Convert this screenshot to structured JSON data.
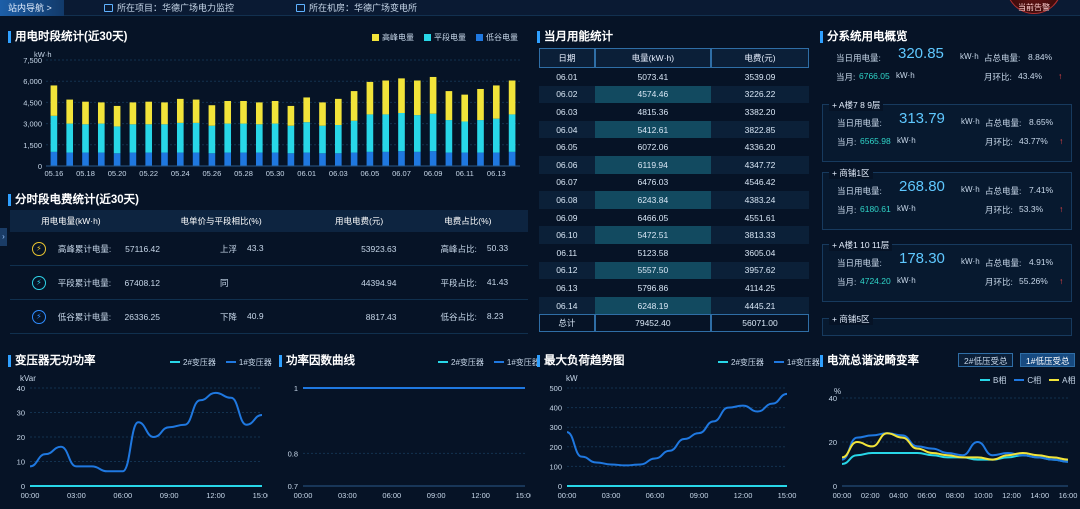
{
  "topbar": {
    "nav_label": "站内导航 >",
    "project_label": "所在项目：华德广场电力监控",
    "room_label": "所在机房：华德广场变电所",
    "alarm_label": "当前告警"
  },
  "usage30": {
    "title": "用电时段统计(近30天)",
    "unit": "kW·h",
    "legend": [
      "高峰电量",
      "平段电量",
      "低谷电量"
    ],
    "colors": {
      "peak": "#f2e43a",
      "flat": "#28d7e8",
      "valley": "#1f78e0"
    }
  },
  "cost30": {
    "title": "分时段电费统计(近30天)",
    "headers": [
      "用电电量(kW·h)",
      "电单价与平段相比(%)",
      "用电电费(元)",
      "电费占比(%)"
    ],
    "rows": [
      {
        "icon": "peak-bolt-icon",
        "label": "高峰累计电量:",
        "value": "57116.42",
        "dir": "上浮",
        "pct": "43.3",
        "money": "53923.63",
        "ratio_label": "高峰占比:",
        "ratio": "50.33"
      },
      {
        "icon": "flat-bolt-icon",
        "label": "平段累计电量:",
        "value": "67408.12",
        "dir": "同",
        "pct": "",
        "money": "44394.94",
        "ratio_label": "平段占比:",
        "ratio": "41.43"
      },
      {
        "icon": "valley-bolt-icon",
        "label": "低谷累计电量:",
        "value": "26336.25",
        "dir": "下降",
        "pct": "40.9",
        "money": "8817.43",
        "ratio_label": "低谷占比:",
        "ratio": "8.23"
      }
    ]
  },
  "monthly": {
    "title": "当月用能统计",
    "headers": [
      "日期",
      "电量(kW·h)",
      "电费(元)"
    ],
    "rows": [
      [
        "06.01",
        "5073.41",
        "3539.09"
      ],
      [
        "06.02",
        "4574.46",
        "3226.22"
      ],
      [
        "06.03",
        "4815.36",
        "3382.20"
      ],
      [
        "06.04",
        "5412.61",
        "3822.85"
      ],
      [
        "06.05",
        "6072.06",
        "4336.20"
      ],
      [
        "06.06",
        "6119.94",
        "4347.72"
      ],
      [
        "06.07",
        "6476.03",
        "4546.42"
      ],
      [
        "06.08",
        "6243.84",
        "4383.24"
      ],
      [
        "06.09",
        "6466.05",
        "4551.61"
      ],
      [
        "06.10",
        "5472.51",
        "3813.33"
      ],
      [
        "06.11",
        "5123.58",
        "3605.04"
      ],
      [
        "06.12",
        "5557.50",
        "3957.62"
      ],
      [
        "06.13",
        "5796.86",
        "4114.25"
      ],
      [
        "06.14",
        "6248.19",
        "4445.21"
      ]
    ],
    "total": [
      "总计",
      "79452.40",
      "56071.00"
    ]
  },
  "subsystems": {
    "title": "分系统用电概览",
    "today_label": "当日用电量:",
    "month_label": "当月:",
    "share_label": "占总电量:",
    "mom_label": "月环比:",
    "unit": "kW·h",
    "cards": [
      {
        "name": "",
        "today": "320.85",
        "share": "8.84%",
        "month": "6766.05",
        "mom": "43.4%"
      },
      {
        "name": "A楼7 8 9层",
        "today": "313.79",
        "share": "8.65%",
        "month": "6565.98",
        "mom": "43.77%"
      },
      {
        "name": "商铺1区",
        "today": "268.80",
        "share": "7.41%",
        "month": "6180.61",
        "mom": "53.3%"
      },
      {
        "name": "A楼1 10 11层",
        "today": "178.30",
        "share": "4.91%",
        "month": "4724.20",
        "mom": "55.26%"
      },
      {
        "name": "商铺5区",
        "today": "",
        "share": "",
        "month": "",
        "mom": ""
      }
    ]
  },
  "reactive": {
    "title": "变压器无功功率",
    "unit": "kVar",
    "legend": [
      "2#变压器",
      "1#变压器"
    ]
  },
  "pf": {
    "title": "功率因数曲线",
    "legend": [
      "2#变压器",
      "1#变压器"
    ]
  },
  "maxload": {
    "title": "最大负荷趋势图",
    "unit": "kW",
    "legend": [
      "2#变压器",
      "1#变压器"
    ]
  },
  "thd": {
    "title": "电流总谐波畸变率",
    "unit": "%",
    "tabs": [
      "2#低压受总",
      "1#低压受总"
    ],
    "legend": [
      "B相",
      "C相",
      "A相"
    ]
  },
  "chart_data": [
    {
      "type": "bar",
      "title": "用电时段统计(近30天)",
      "ylabel": "kW·h",
      "ylim": [
        0,
        7500
      ],
      "yticks": [
        0,
        1500,
        3000,
        4500,
        6000,
        7500
      ],
      "categories": [
        "05.16",
        "05.17",
        "05.18",
        "05.19",
        "05.20",
        "05.21",
        "05.22",
        "05.23",
        "05.24",
        "05.25",
        "05.26",
        "05.27",
        "05.28",
        "05.29",
        "05.30",
        "05.31",
        "06.01",
        "06.02",
        "06.03",
        "06.04",
        "06.05",
        "06.06",
        "06.07",
        "06.08",
        "06.09",
        "06.10",
        "06.11",
        "06.12",
        "06.13",
        "06.14"
      ],
      "xtick_labels": [
        "05.16",
        "05.18",
        "05.20",
        "05.22",
        "05.24",
        "05.26",
        "05.28",
        "05.30",
        "06.01",
        "06.03",
        "06.05",
        "06.07",
        "06.09",
        "06.11",
        "06.13"
      ],
      "stacked": true,
      "series": [
        {
          "name": "低谷电量",
          "values": [
            1000,
            950,
            950,
            950,
            900,
            950,
            950,
            950,
            950,
            950,
            900,
            950,
            950,
            950,
            950,
            900,
            950,
            900,
            900,
            950,
            1000,
            1000,
            1050,
            1000,
            1050,
            950,
            950,
            950,
            950,
            1000
          ]
        },
        {
          "name": "平段电量",
          "values": [
            2550,
            2050,
            2000,
            2050,
            1900,
            2000,
            2000,
            2000,
            2100,
            2100,
            1950,
            2050,
            2050,
            2000,
            2050,
            1950,
            2150,
            1950,
            2000,
            2250,
            2650,
            2650,
            2700,
            2600,
            2650,
            2300,
            2200,
            2300,
            2400,
            2650
          ]
        },
        {
          "name": "高峰电量",
          "values": [
            2150,
            1700,
            1600,
            1500,
            1450,
            1550,
            1600,
            1550,
            1700,
            1650,
            1450,
            1600,
            1600,
            1550,
            1600,
            1400,
            1750,
            1650,
            1850,
            2100,
            2300,
            2400,
            2450,
            2450,
            2600,
            2050,
            1900,
            2200,
            2350,
            2400
          ]
        }
      ]
    },
    {
      "type": "line",
      "title": "变压器无功功率",
      "ylabel": "kVar",
      "ylim": [
        0,
        40
      ],
      "yticks": [
        0,
        10,
        20,
        30,
        40
      ],
      "xtick_labels": [
        "00:00",
        "03:00",
        "06:00",
        "09:00",
        "12:00",
        "15:00"
      ],
      "x": [
        0,
        1,
        2,
        3,
        4,
        5,
        6,
        7,
        8,
        9,
        10,
        11,
        12,
        13,
        14,
        15
      ],
      "series": [
        {
          "name": "2#变压器",
          "values": [
            0,
            0,
            0,
            0,
            0,
            0,
            0,
            0,
            0,
            0,
            0,
            0,
            0,
            0,
            0,
            0
          ]
        },
        {
          "name": "1#变压器",
          "values": [
            8,
            13,
            16,
            8,
            8,
            6,
            6,
            26,
            20,
            24,
            25,
            35,
            38,
            36,
            25,
            29
          ]
        }
      ]
    },
    {
      "type": "line",
      "title": "功率因数曲线",
      "ylim": [
        0.7,
        1
      ],
      "yticks": [
        0.7,
        0.8,
        1
      ],
      "xtick_labels": [
        "00:00",
        "03:00",
        "06:00",
        "09:00",
        "12:00",
        "15:00"
      ],
      "x": [
        0,
        15
      ],
      "series": [
        {
          "name": "2#变压器",
          "values": [
            1,
            1
          ]
        },
        {
          "name": "1#变压器",
          "values": [
            1,
            1
          ]
        }
      ]
    },
    {
      "type": "line",
      "title": "最大负荷趋势图",
      "ylabel": "kW",
      "ylim": [
        0,
        500
      ],
      "yticks": [
        0,
        100,
        200,
        300,
        400,
        500
      ],
      "xtick_labels": [
        "00:00",
        "03:00",
        "06:00",
        "09:00",
        "12:00",
        "15:00"
      ],
      "x": [
        0,
        1,
        2,
        3,
        4,
        5,
        6,
        7,
        8,
        9,
        10,
        11,
        12,
        13,
        14,
        15
      ],
      "series": [
        {
          "name": "2#变压器",
          "values": [
            0,
            0,
            0,
            0,
            0,
            0,
            0,
            0,
            0,
            0,
            0,
            0,
            0,
            0,
            0,
            0
          ]
        },
        {
          "name": "1#变压器",
          "values": [
            275,
            150,
            120,
            110,
            105,
            110,
            140,
            180,
            240,
            270,
            330,
            400,
            410,
            380,
            420,
            470
          ]
        }
      ]
    },
    {
      "type": "line",
      "title": "电流总谐波畸变率",
      "ylabel": "%",
      "ylim": [
        0,
        40
      ],
      "yticks": [
        0,
        20,
        40
      ],
      "xtick_labels": [
        "00:00",
        "02:00",
        "04:00",
        "06:00",
        "08:00",
        "10:00",
        "12:00",
        "14:00",
        "16:00"
      ],
      "x": [
        0,
        1,
        2,
        3,
        4,
        5,
        6,
        7,
        8,
        9,
        10,
        11,
        12,
        13,
        14,
        15
      ],
      "series": [
        {
          "name": "B相",
          "values": [
            10,
            14,
            15,
            15,
            15,
            15,
            14,
            13,
            13,
            12,
            12,
            13,
            14,
            13,
            12,
            11
          ]
        },
        {
          "name": "C相",
          "values": [
            12,
            22,
            23,
            24,
            23,
            18,
            17,
            15,
            14,
            20,
            14,
            15,
            14,
            13,
            12,
            11
          ]
        },
        {
          "name": "A相",
          "values": [
            13,
            20,
            18,
            24,
            22,
            17,
            15,
            14,
            13,
            13,
            12,
            14,
            15,
            14,
            13,
            12
          ]
        }
      ]
    }
  ]
}
